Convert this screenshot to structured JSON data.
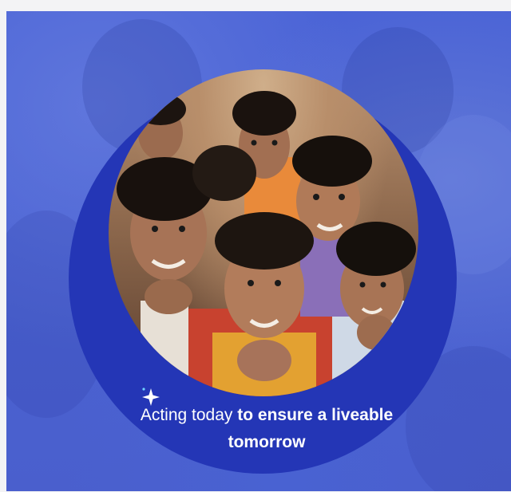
{
  "hero": {
    "headline_regular": "Acting today",
    "headline_bold": "to ensure a liveable tomorrow",
    "photo": "group of smiling children",
    "icon": "sparkle-icon"
  },
  "colors": {
    "banner": "#4b62d1",
    "circle": "#2436b6",
    "text": "#ffffff"
  }
}
